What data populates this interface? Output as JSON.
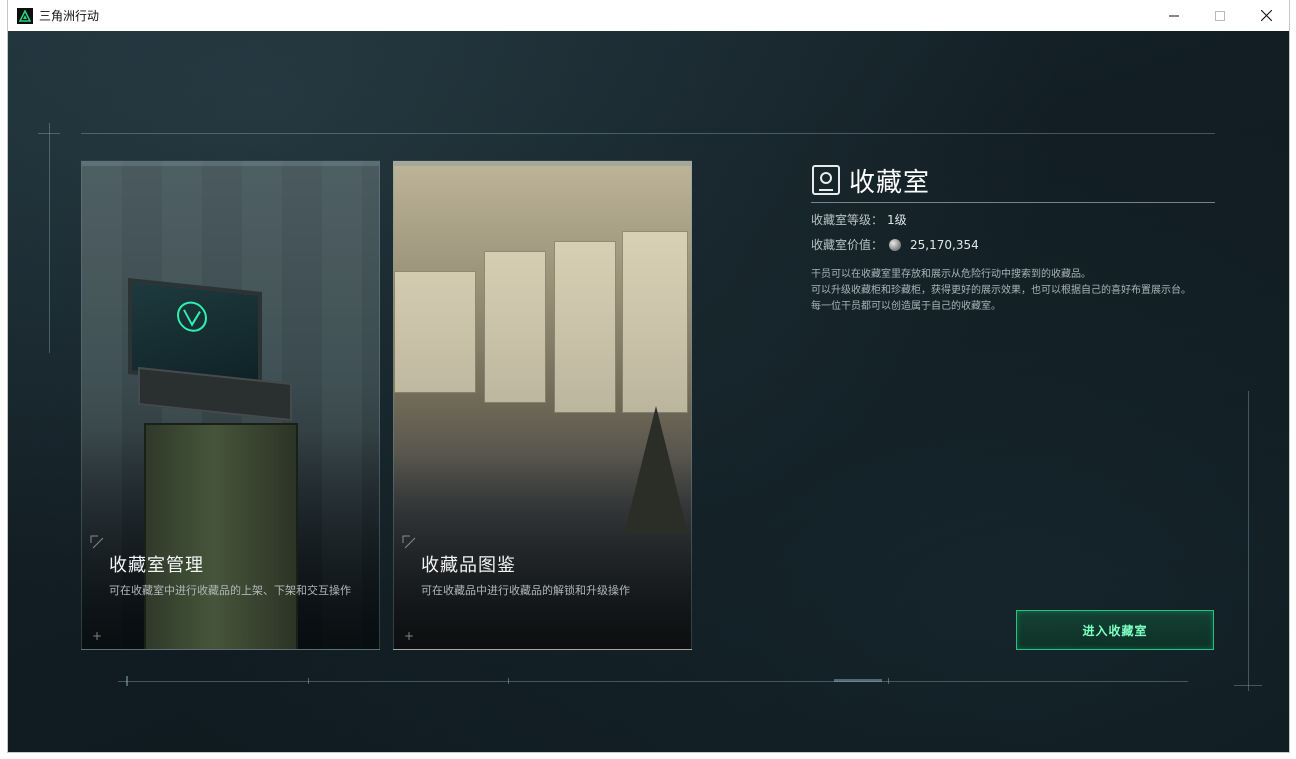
{
  "window": {
    "title": "三角洲行动",
    "controls": [
      "minimize-icon",
      "maximize-icon",
      "close-icon"
    ]
  },
  "cards": [
    {
      "title": "收藏室管理",
      "desc": "可在收藏室中进行收藏品的上架、下架和交互操作"
    },
    {
      "title": "收藏品图鉴",
      "desc": "可在收藏品中进行收藏品的解锁和升级操作"
    }
  ],
  "info": {
    "title": "收藏室",
    "level_label": "收藏室等级：",
    "level_value": "1级",
    "value_label": "收藏室价值：",
    "value_amount": "25,170,354",
    "desc": [
      "干员可以在收藏室里存放和展示从危险行动中搜索到的收藏品。",
      "可以升级收藏柜和珍藏柜，获得更好的展示效果，也可以根据自己的喜好布置展示台。",
      "每一位干员都可以创造属于自己的收藏室。"
    ]
  },
  "actions": {
    "enter_label": "进入收藏室"
  },
  "colors": {
    "accent": "#24c37e",
    "accent_text": "#7dffc2",
    "background": "#0f1a20"
  }
}
